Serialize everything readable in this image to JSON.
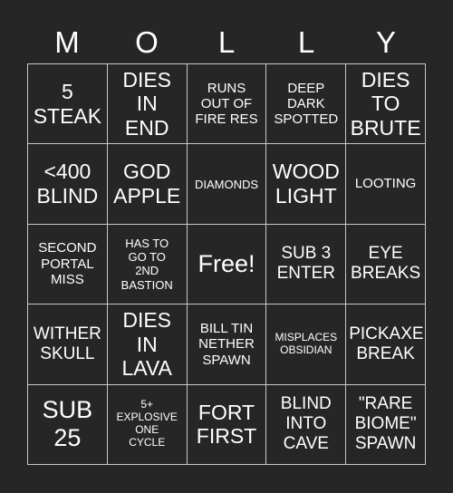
{
  "card": {
    "header_letters": [
      "M",
      "O",
      "L",
      "L",
      "Y"
    ],
    "colors": {
      "background": "#262626",
      "text": "#ffffff",
      "grid_line": "#c8c8c8"
    },
    "rows": [
      [
        {
          "text": "5\nSTEAK",
          "size": "lg"
        },
        {
          "text": "DIES\nIN\nEND",
          "size": "lg"
        },
        {
          "text": "RUNS\nOUT OF\nFIRE RES",
          "size": "sm"
        },
        {
          "text": "DEEP\nDARK\nSPOTTED",
          "size": "sm"
        },
        {
          "text": "DIES\nTO\nBRUTE",
          "size": "lg"
        }
      ],
      [
        {
          "text": "<400\nBLIND",
          "size": "lg"
        },
        {
          "text": "GOD\nAPPLE",
          "size": "lg"
        },
        {
          "text": "DIAMONDS",
          "size": "xs"
        },
        {
          "text": "WOOD\nLIGHT",
          "size": "lg"
        },
        {
          "text": "LOOTING",
          "size": "sm"
        }
      ],
      [
        {
          "text": "SECOND\nPORTAL\nMISS",
          "size": "sm"
        },
        {
          "text": "HAS TO\nGO TO\n2ND\nBASTION",
          "size": "xs"
        },
        {
          "text": "Free!",
          "size": "xl"
        },
        {
          "text": "SUB 3\nENTER",
          "size": "md"
        },
        {
          "text": "EYE\nBREAKS",
          "size": "md"
        }
      ],
      [
        {
          "text": "WITHER\nSKULL",
          "size": "md"
        },
        {
          "text": "DIES\nIN\nLAVA",
          "size": "lg"
        },
        {
          "text": "BILL TIN\nNETHER\nSPAWN",
          "size": "sm"
        },
        {
          "text": "MISPLACES\nOBSIDIAN",
          "size": "xxs"
        },
        {
          "text": "PICKAXE\nBREAK",
          "size": "md"
        }
      ],
      [
        {
          "text": "SUB\n25",
          "size": "xl"
        },
        {
          "text": "5+\nEXPLOSIVE\nONE\nCYCLE",
          "size": "xxs"
        },
        {
          "text": "FORT\nFIRST",
          "size": "lg"
        },
        {
          "text": "BLIND\nINTO\nCAVE",
          "size": "md"
        },
        {
          "text": "\"RARE\nBIOME\"\nSPAWN",
          "size": "md"
        }
      ]
    ]
  }
}
